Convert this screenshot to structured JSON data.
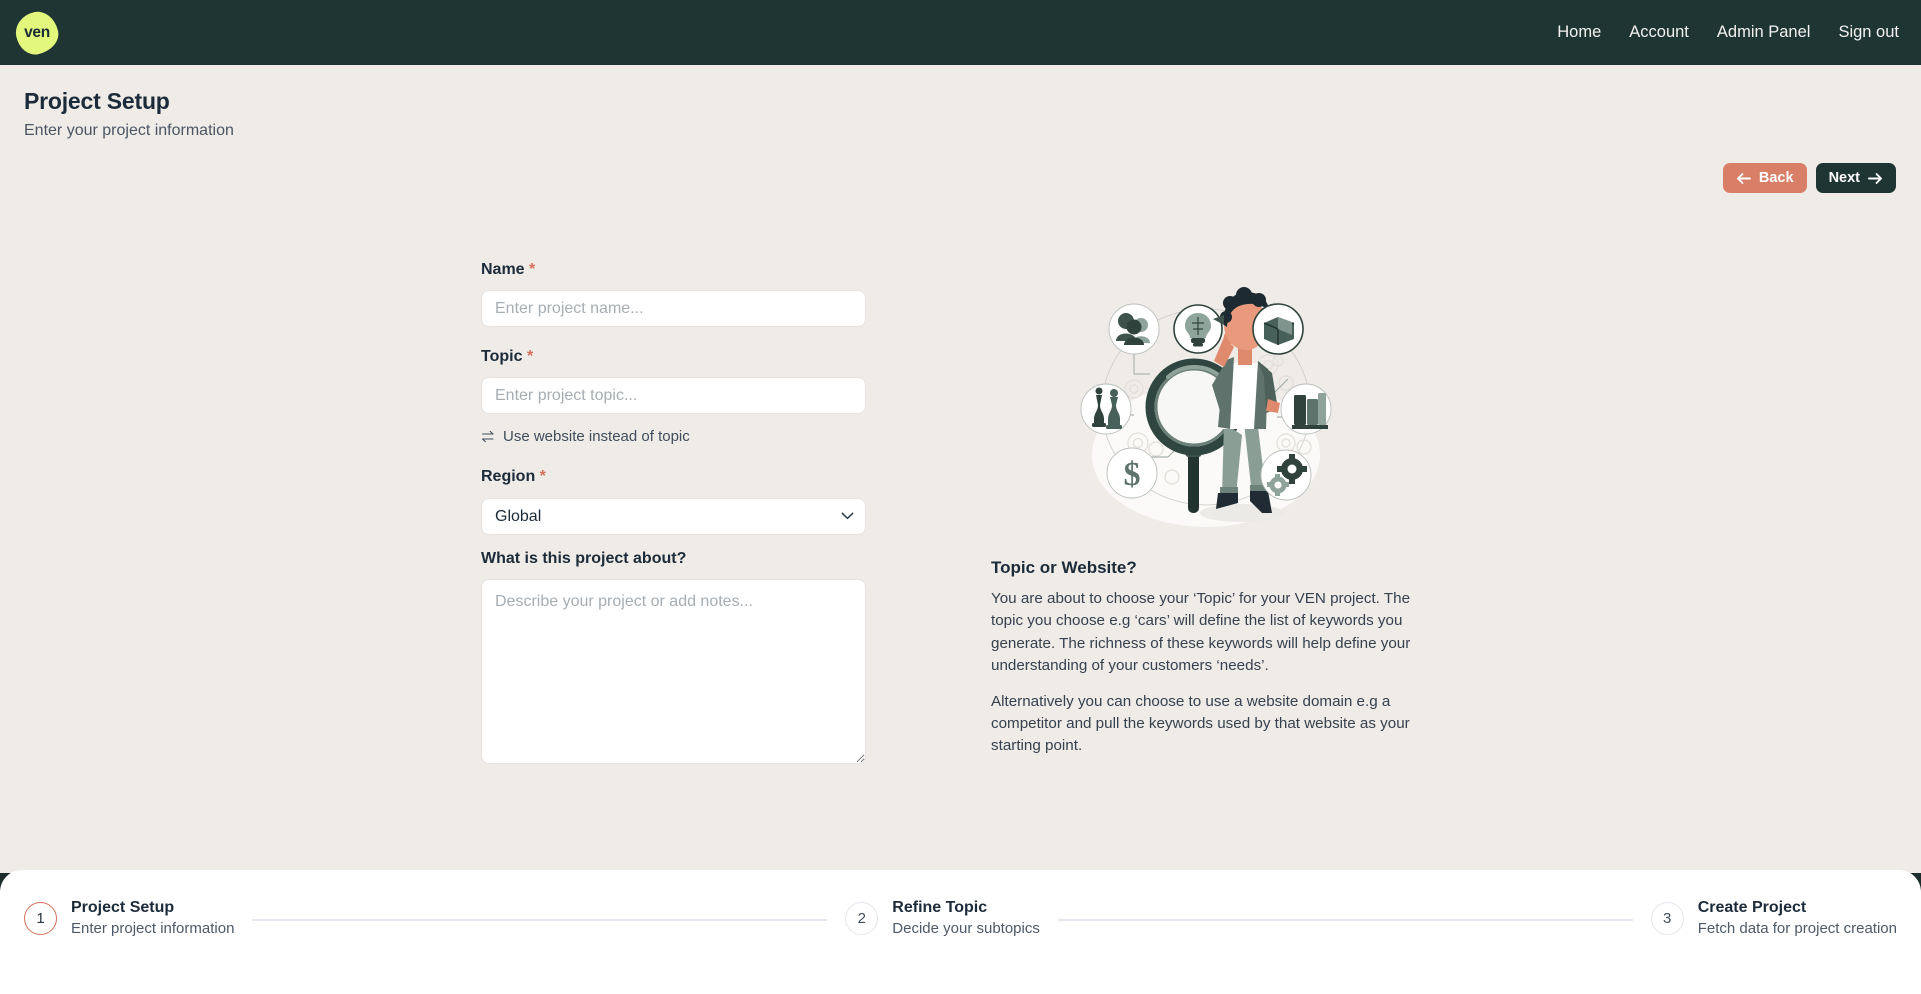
{
  "brand": {
    "logo_text": "ven",
    "logo_color": "#e2f77c"
  },
  "nav": {
    "items": [
      {
        "label": "Home"
      },
      {
        "label": "Account"
      },
      {
        "label": "Admin Panel"
      },
      {
        "label": "Sign out"
      }
    ]
  },
  "header": {
    "title": "Project Setup",
    "subtitle": "Enter your project information",
    "back_label": "Back",
    "next_label": "Next",
    "back_color": "#d97f67",
    "next_color": "#1e3533"
  },
  "form": {
    "name": {
      "label": "Name",
      "required_marker": "*",
      "placeholder": "Enter project name...",
      "value": ""
    },
    "topic": {
      "label": "Topic",
      "required_marker": "*",
      "placeholder": "Enter project topic...",
      "value": ""
    },
    "swap_link": {
      "label": "Use website instead of topic",
      "icon": "swap-arrows-icon"
    },
    "region": {
      "label": "Region",
      "required_marker": "*",
      "selected": "Global",
      "options": [
        "Global"
      ]
    },
    "notes": {
      "label": "What is this project about?",
      "placeholder": "Describe your project or add notes...",
      "value": ""
    }
  },
  "info": {
    "illustration_name": "research-magnifying-glass-illustration",
    "title": "Topic or Website?",
    "paragraph1": "You are about to choose your ‘Topic’ for your VEN project. The topic you choose e.g ‘cars’ will define the list of keywords you generate. The richness of these keywords will help define your understanding of your customers ‘needs’.",
    "paragraph2": "Alternatively you can choose to use a website domain e.g a competitor and pull the keywords used by that website as your starting point."
  },
  "stepper": {
    "steps": [
      {
        "number": "1",
        "title": "Project Setup",
        "desc": "Enter project information",
        "active": true
      },
      {
        "number": "2",
        "title": "Refine Topic",
        "desc": "Decide your subtopics",
        "active": false
      },
      {
        "number": "3",
        "title": "Create Project",
        "desc": "Fetch data for project creation",
        "active": false
      }
    ],
    "active_color": "#d4705a"
  }
}
